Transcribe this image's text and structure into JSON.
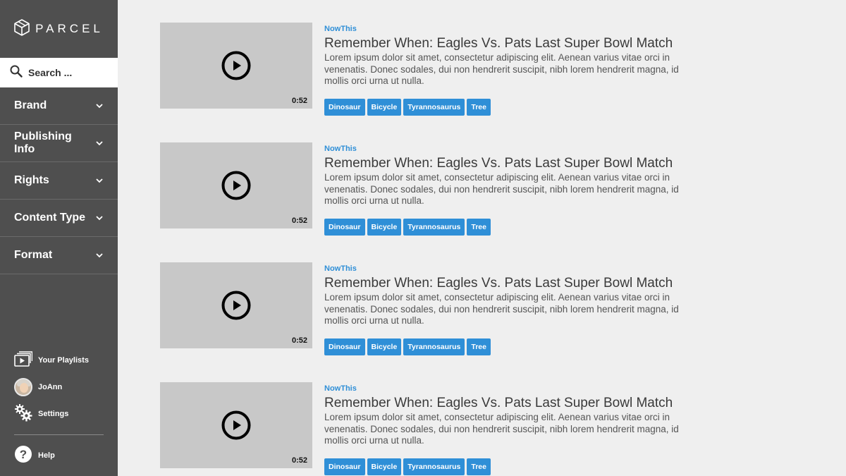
{
  "app": {
    "logo_text": "PARCEL"
  },
  "search": {
    "placeholder": "Search ..."
  },
  "filters": [
    {
      "label": "Brand"
    },
    {
      "label": "Publishing Info"
    },
    {
      "label": "Rights"
    },
    {
      "label": "Content Type"
    },
    {
      "label": "Format"
    }
  ],
  "bottom_nav": {
    "playlists": "Your Playlists",
    "user": "JoAnn",
    "settings": "Settings",
    "help": "Help"
  },
  "videos": [
    {
      "brand": "NowThis",
      "title": "Remember When: Eagles Vs. Pats Last Super Bowl Match",
      "description": "Lorem ipsum dolor sit amet, consectetur adipiscing elit. Aenean varius vitae orci in venenatis. Donec sodales, dui non hendrerit suscipit, nibh lorem hendrerit magna, id mollis orci urna ut nulla.",
      "duration": "0:52",
      "tags": [
        "Dinosaur",
        "Bicycle",
        "Tyrannosaurus",
        "Tree"
      ]
    },
    {
      "brand": "NowThis",
      "title": "Remember When: Eagles Vs. Pats Last Super Bowl Match",
      "description": "Lorem ipsum dolor sit amet, consectetur adipiscing elit. Aenean varius vitae orci in venenatis. Donec sodales, dui non hendrerit suscipit, nibh lorem hendrerit magna, id mollis orci urna ut nulla.",
      "duration": "0:52",
      "tags": [
        "Dinosaur",
        "Bicycle",
        "Tyrannosaurus",
        "Tree"
      ]
    },
    {
      "brand": "NowThis",
      "title": "Remember When: Eagles Vs. Pats Last Super Bowl Match",
      "description": "Lorem ipsum dolor sit amet, consectetur adipiscing elit. Aenean varius vitae orci in venenatis. Donec sodales, dui non hendrerit suscipit, nibh lorem hendrerit magna, id mollis orci urna ut nulla.",
      "duration": "0:52",
      "tags": [
        "Dinosaur",
        "Bicycle",
        "Tyrannosaurus",
        "Tree"
      ]
    },
    {
      "brand": "NowThis",
      "title": "Remember When: Eagles Vs. Pats Last Super Bowl Match",
      "description": "Lorem ipsum dolor sit amet, consectetur adipiscing elit. Aenean varius vitae orci in venenatis. Donec sodales, dui non hendrerit suscipit, nibh lorem hendrerit magna, id mollis orci urna ut nulla.",
      "duration": "0:52",
      "tags": [
        "Dinosaur",
        "Bicycle",
        "Tyrannosaurus",
        "Tree"
      ]
    }
  ],
  "colors": {
    "sidebar": "#4f4f4f",
    "accent": "#2f8fd7",
    "background": "#efefef",
    "thumbnail": "#c8c8c8"
  }
}
